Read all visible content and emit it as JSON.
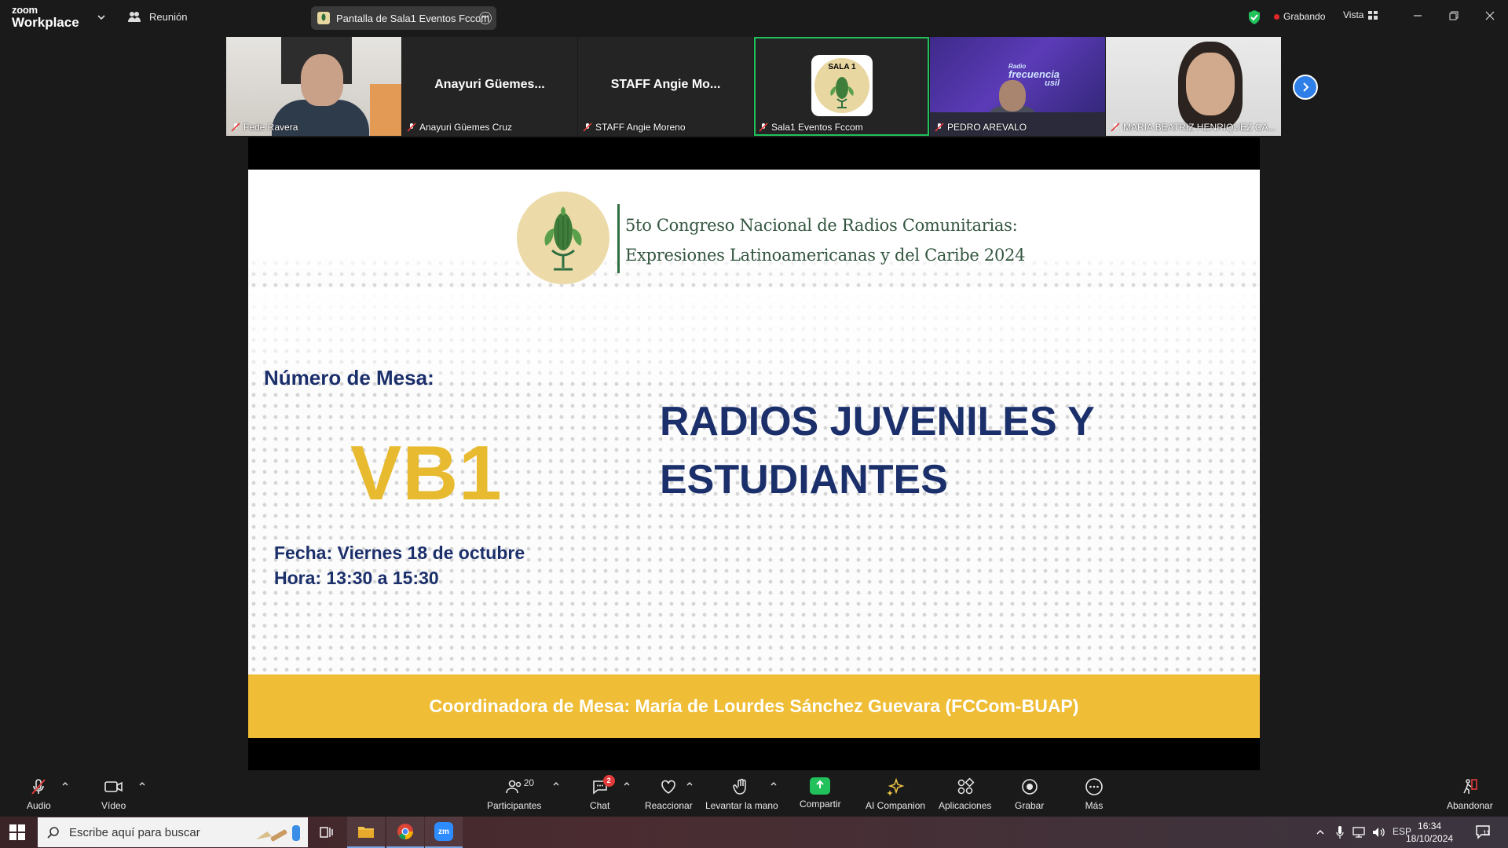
{
  "app": {
    "logo_line1": "zoom",
    "logo_line2": "Workplace",
    "meeting_label": "Reunión"
  },
  "share_pill": {
    "label": "Pantalla de Sala1 Eventos Fccom"
  },
  "status": {
    "recording": "Grabando",
    "view": "Vista"
  },
  "participants": [
    {
      "name": "Fede Ravera",
      "big_label": "",
      "video": "person-room"
    },
    {
      "name": "Anayuri Güemes Cruz",
      "big_label": "Anayuri Güemes...",
      "video": "none"
    },
    {
      "name": "STAFF Angie Moreno",
      "big_label": "STAFF  Angie Mo...",
      "video": "none"
    },
    {
      "name": "Sala1 Eventos Fccom",
      "big_label": "",
      "video": "avatar",
      "avatar_text": "SALA 1",
      "active": true
    },
    {
      "name": "PEDRO AREVALO",
      "big_label": "",
      "video": "radio-studio",
      "brand_line1": "Radio",
      "brand_line2": "frecuencia",
      "brand_line3": "usil"
    },
    {
      "name": "MARIA BEATRIZ HENRIQUEZ CA...",
      "big_label": "",
      "video": "person-woman"
    }
  ],
  "slide": {
    "congress_line1": "5to Congreso Nacional de Radios Comunitarias:",
    "congress_line2": "Expresiones Latinoamericanas y del Caribe 2024",
    "mesa_label": "Número de Mesa:",
    "mesa_code": "VB1",
    "mesa_title": "RADIOS JUVENILES Y ESTUDIANTES",
    "fecha": "Fecha: Viernes 18 de octubre",
    "hora": "Hora: 13:30 a 15:30",
    "coordinadora": "Coordinadora de Mesa: María de Lourdes Sánchez Guevara (FCCom-BUAP)"
  },
  "toolbar": {
    "audio": "Audio",
    "video": "Vídeo",
    "participants": "Participantes",
    "participants_count": "20",
    "chat": "Chat",
    "chat_badge": "2",
    "react": "Reaccionar",
    "raise_hand": "Levantar la mano",
    "share": "Compartir",
    "ai": "AI Companion",
    "apps": "Aplicaciones",
    "record": "Grabar",
    "more": "Más",
    "leave": "Abandonar"
  },
  "taskbar": {
    "search_placeholder": "Escribe aquí para buscar",
    "lang": "ESP",
    "time": "16:34",
    "date": "18/10/2024",
    "notif_count": "11"
  },
  "colors": {
    "slide_navy": "#1b2f6b",
    "slide_gold": "#efbd36",
    "active_green": "#21c15b",
    "share_green": "#21c15b",
    "record_red": "#e02828"
  }
}
